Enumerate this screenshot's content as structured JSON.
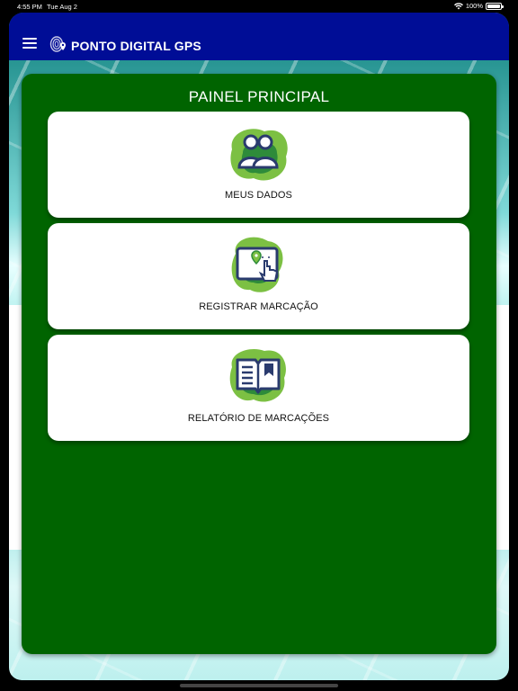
{
  "status_bar": {
    "time": "4:55 PM",
    "date": "Tue Aug 2",
    "battery": "100%"
  },
  "app": {
    "title": "PONTO DIGITAL GPS"
  },
  "panel": {
    "title": "PAINEL PRINCIPAL",
    "cards": [
      {
        "label": "MEUS DADOS",
        "icon": "users-icon"
      },
      {
        "label": "REGISTRAR MARCAÇÃO",
        "icon": "tablet-location-touch-icon"
      },
      {
        "label": "RELATÓRIO DE MARCAÇÕES",
        "icon": "open-book-report-icon"
      }
    ]
  },
  "colors": {
    "appbar": "#000d96",
    "panel": "#006400",
    "icon_green": "#7cc043",
    "icon_dark_green": "#2e8b3a",
    "icon_navy": "#2a3b6e"
  }
}
